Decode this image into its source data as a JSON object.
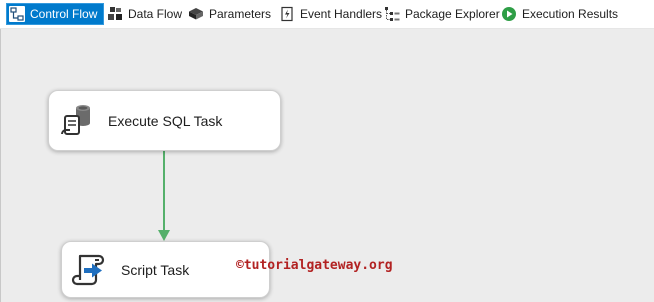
{
  "tabs": {
    "control_flow": "Control Flow",
    "data_flow": "Data Flow",
    "parameters": "Parameters",
    "event_handlers": "Event Handlers",
    "package_explorer": "Package Explorer",
    "execution_results": "Execution Results",
    "active": "control_flow"
  },
  "tasks": {
    "execute_sql": "Execute SQL Task",
    "script": "Script Task"
  },
  "watermark": "©tutorialgateway.org",
  "colors": {
    "active_tab": "#007acc",
    "connector": "#55b06b",
    "watermark": "#b22222",
    "canvas": "#ececec"
  },
  "icons": {
    "control_flow": "control-flow-icon",
    "data_flow": "data-flow-icon",
    "parameters": "parameters-icon",
    "event_handlers": "event-handlers-icon",
    "package_explorer": "package-explorer-icon",
    "execution_results": "execution-results-icon",
    "execute_sql": "execute-sql-icon",
    "script": "script-task-icon"
  }
}
